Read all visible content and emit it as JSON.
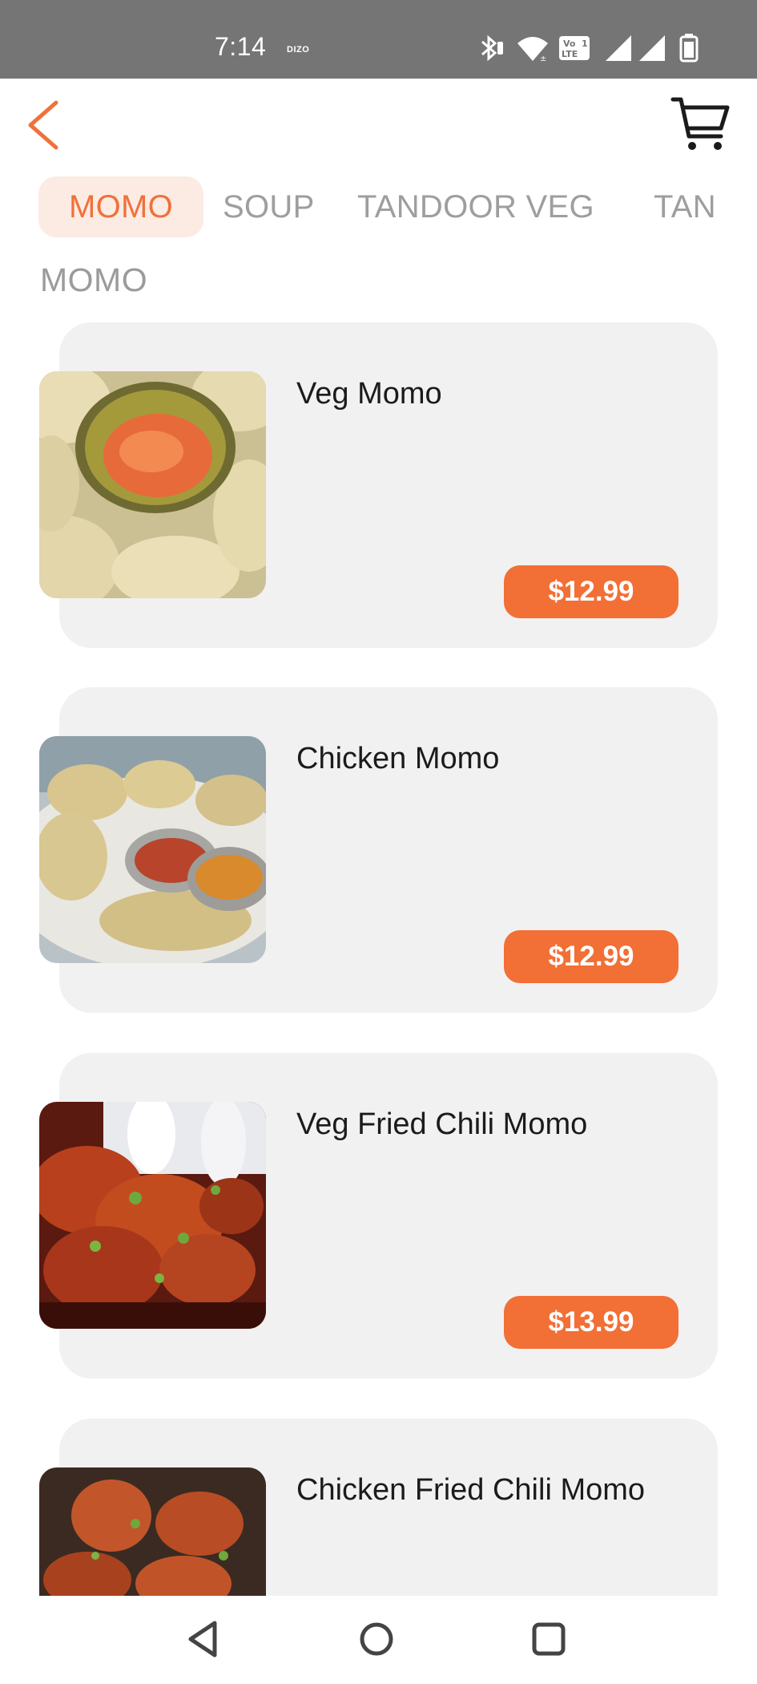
{
  "status_bar": {
    "time": "7:14",
    "carrier": "DIZO",
    "lte_badge": "Vo LTE 1",
    "icons": [
      "bluetooth-icon",
      "wifi-icon",
      "volte-icon",
      "signal-icon",
      "signal-icon",
      "battery-icon"
    ]
  },
  "header": {
    "back_icon": "chevron-left-icon",
    "cart_icon": "cart-icon",
    "accent_color": "#f0713b"
  },
  "tabs": [
    {
      "label": "MOMO",
      "active": true
    },
    {
      "label": "SOUP",
      "active": false
    },
    {
      "label": "TANDOOR VEG",
      "active": false
    },
    {
      "label": "TAN",
      "active": false
    }
  ],
  "section": {
    "title": "MOMO"
  },
  "items": [
    {
      "name": "Veg Momo",
      "price": "$12.99"
    },
    {
      "name": "Chicken Momo",
      "price": "$12.99"
    },
    {
      "name": "Veg Fried Chili Momo",
      "price": "$13.99"
    },
    {
      "name": "Chicken Fried Chili Momo",
      "price": ""
    }
  ],
  "nav_bar": {
    "icons": [
      "back-triangle-icon",
      "home-circle-icon",
      "recents-square-icon"
    ]
  },
  "colors": {
    "price_button": "#f26f35",
    "card_background": "#f1f1f1",
    "active_tab_background": "#fcebe3"
  }
}
